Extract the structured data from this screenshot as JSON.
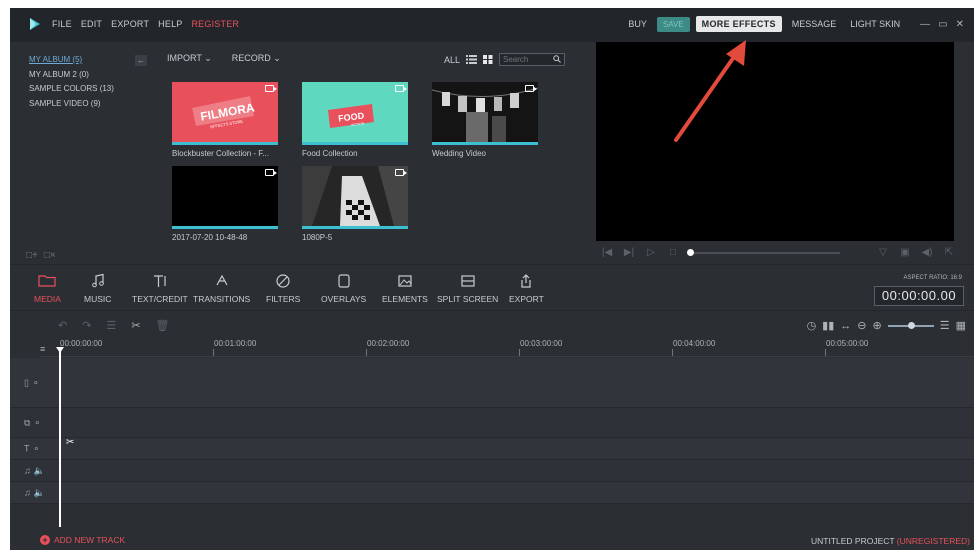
{
  "titlebar": {
    "menu": [
      "FILE",
      "EDIT",
      "EXPORT",
      "HELP",
      "REGISTER"
    ],
    "right": {
      "buy": "BUY",
      "save": "SAVE",
      "more_effects": "MORE EFFECTS",
      "message": "MESSAGE",
      "light_skin": "LIGHT SKIN"
    }
  },
  "library": {
    "albums": [
      "MY ALBUM (5)",
      "MY ALBUM 2 (0)",
      "SAMPLE COLORS (13)",
      "SAMPLE VIDEO (9)"
    ],
    "import_label": "IMPORT",
    "record_label": "RECORD",
    "all_label": "ALL",
    "search_placeholder": "Search",
    "items": [
      {
        "caption": "Blockbuster Collection - F...",
        "title_text": "FILMORA",
        "subtitle_text": "EFFECTS STORE",
        "bg": "#e8505b"
      },
      {
        "caption": "Food Collection",
        "title_text": "FOOD",
        "subtitle_text": "ACTION",
        "bg": "#5fd8c0"
      },
      {
        "caption": "Wedding Video",
        "bg": "#1a1a1a"
      },
      {
        "caption": "2017-07-20 10-48-48",
        "bg": "#000000"
      },
      {
        "caption": "1080P-5",
        "bg": "#2a2a2a"
      }
    ]
  },
  "tools": {
    "items": [
      "MEDIA",
      "MUSIC",
      "TEXT/CREDIT",
      "TRANSITIONS",
      "FILTERS",
      "OVERLAYS",
      "ELEMENTS",
      "SPLIT SCREEN",
      "EXPORT"
    ],
    "aspect_ratio": "ASPECT RATIO: 16:9",
    "timecode": "00:00:00.00"
  },
  "timeline": {
    "ticks": [
      "00:00:00:00",
      "00:01:00:00",
      "00:02:00:00",
      "00:03:00:00",
      "00:04:00:00",
      "00:05:00:00"
    ],
    "add_track": "ADD NEW TRACK",
    "project_name": "UNTITLED PROJECT",
    "project_status": "(UNREGISTERED)"
  },
  "colors": {
    "accent": "#e8505b",
    "teal": "#3dbfd2",
    "annotation_arrow": "#e24a3b"
  }
}
